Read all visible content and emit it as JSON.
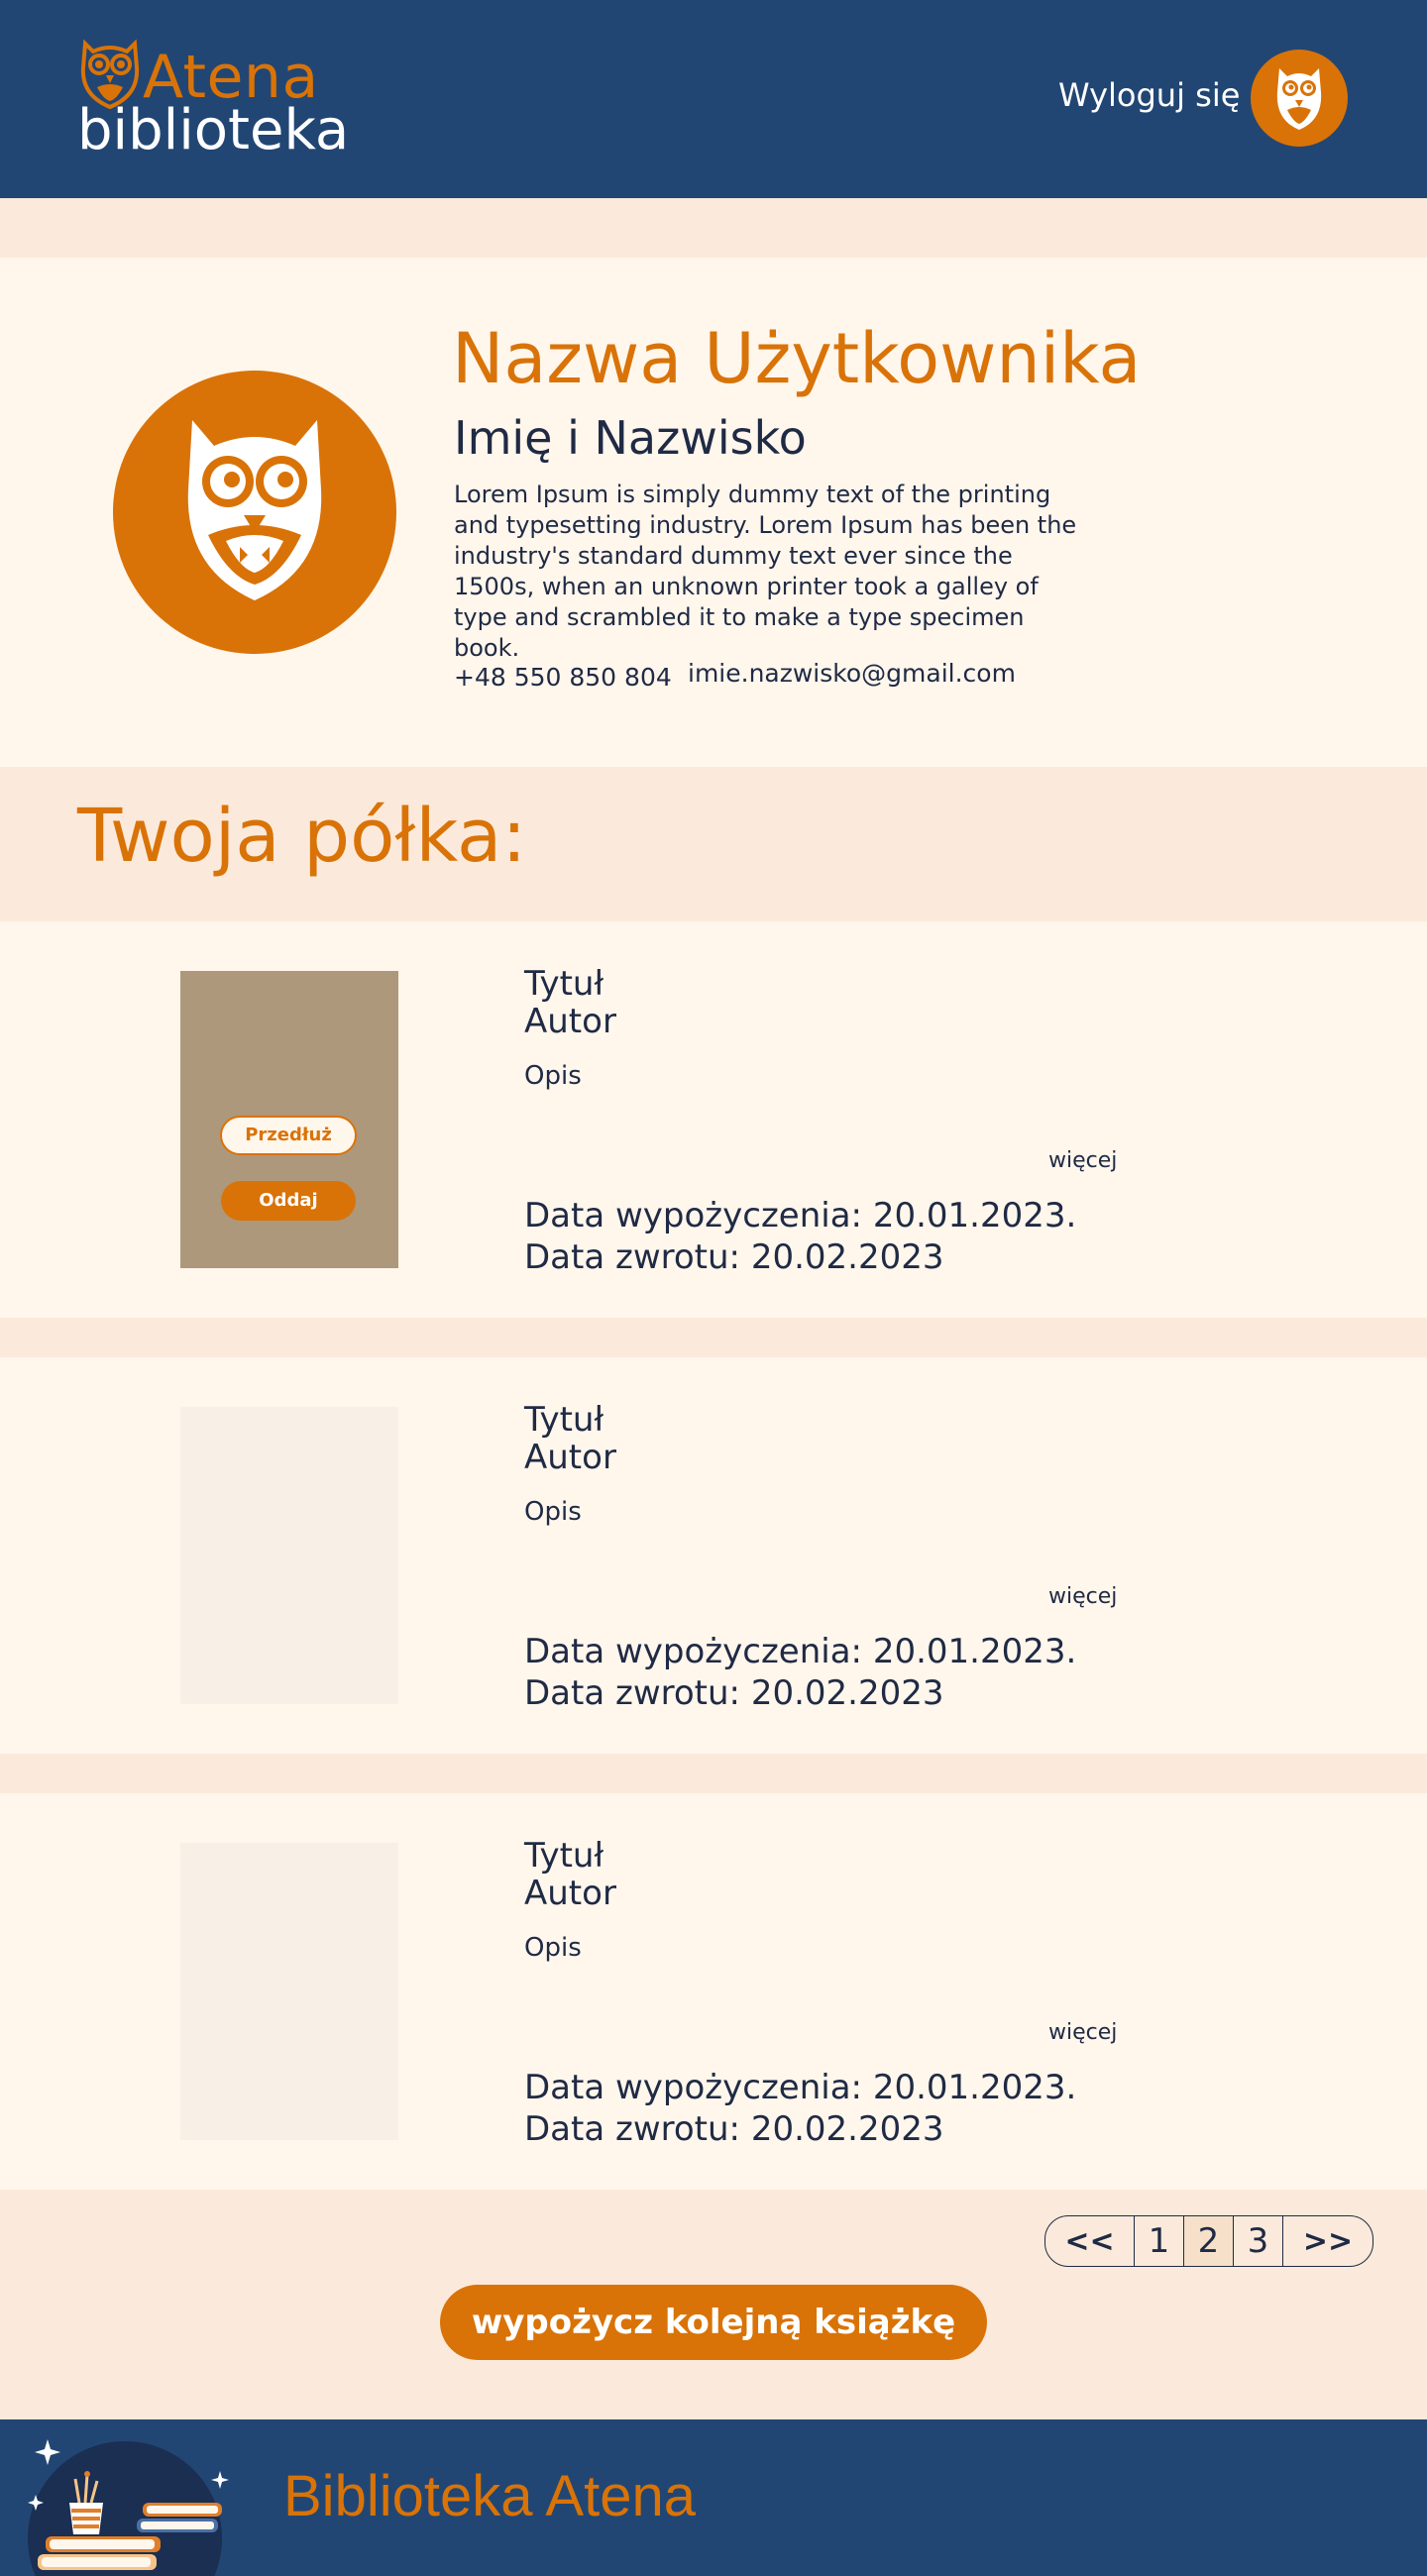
{
  "header": {
    "logo_top": "Atena",
    "logo_bottom": "biblioteka",
    "logout_label": "Wyloguj się",
    "avatar_icon": "owl-icon"
  },
  "profile": {
    "username": "Nazwa Użytkownika",
    "fullname": "Imię i Nazwisko",
    "bio": "Lorem Ipsum is simply dummy text of the printing and typesetting industry. Lorem Ipsum has been the industry's standard dummy text ever since the 1500s, when an unknown printer took a galley of type and scrambled it to make a type specimen book.",
    "phone": "+48 550 850 804",
    "email": "imie.nazwisko@gmail.com"
  },
  "shelf": {
    "title": "Twoja półka:",
    "books": [
      {
        "title": "Tytuł",
        "author": "Autor",
        "description": "Opis",
        "more_label": "więcej",
        "borrow_date": "Data wypożyczenia:  20.01.2023.",
        "return_date": "Data zwrotu: 20.02.2023",
        "extend_label": "Przedłuż",
        "return_label": "Oddaj"
      },
      {
        "title": "Tytuł",
        "author": "Autor",
        "description": "Opis",
        "more_label": "więcej",
        "borrow_date": "Data wypożyczenia:  20.01.2023.",
        "return_date": "Data zwrotu: 20.02.2023"
      },
      {
        "title": "Tytuł",
        "author": "Autor",
        "description": "Opis",
        "more_label": "więcej",
        "borrow_date": "Data wypożyczenia:  20.01.2023.",
        "return_date": "Data zwrotu: 20.02.2023"
      }
    ]
  },
  "pagination": {
    "prev": "<<",
    "pages": [
      "1",
      "2",
      "3"
    ],
    "current_page": "2",
    "next": ">>"
  },
  "cta_label": "wypożycz kolejną książkę",
  "footer": {
    "title": "Biblioteka Atena"
  },
  "colors": {
    "header_bg": "#224673",
    "accent": "#d97308",
    "page_bg": "#fbeadb",
    "card_bg": "#fff6ec",
    "text": "#1f2a44"
  }
}
